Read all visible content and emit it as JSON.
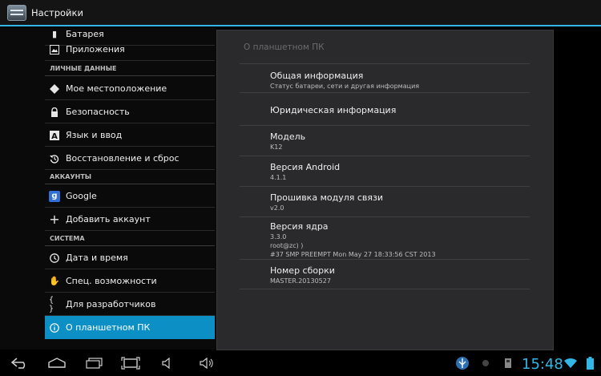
{
  "actionbar": {
    "title": "Настройки"
  },
  "left": {
    "items": [
      {
        "label": "Батарея",
        "icon": "battery-icon"
      },
      {
        "label": "Приложения",
        "icon": "apps-icon"
      },
      {
        "header": "ЛИЧНЫЕ ДАННЫЕ"
      },
      {
        "label": "Мое местоположение",
        "icon": "location-icon"
      },
      {
        "label": "Безопасность",
        "icon": "lock-icon"
      },
      {
        "label": "Язык и ввод",
        "icon": "keyboard-icon"
      },
      {
        "label": "Восстановление и сброс",
        "icon": "restore-icon"
      },
      {
        "header": "АККАУНТЫ"
      },
      {
        "label": "Google",
        "icon": "google-icon"
      },
      {
        "label": "Добавить аккаунт",
        "icon": "add-icon"
      },
      {
        "header": "СИСТЕМА"
      },
      {
        "label": "Дата и время",
        "icon": "clock-icon"
      },
      {
        "label": "Спец. возможности",
        "icon": "hand-icon"
      },
      {
        "label": "Для разработчиков",
        "icon": "braces-icon"
      },
      {
        "label": "О планшетном ПК",
        "icon": "info-icon",
        "selected": true
      }
    ]
  },
  "right": {
    "title": "О планшетном ПК",
    "general": {
      "title": "Общая информация",
      "subtitle": "Статус батареи, сети и другая информация"
    },
    "legal": {
      "title": "Юридическая информация"
    },
    "model": {
      "title": "Модель",
      "value": "K12"
    },
    "android": {
      "title": "Версия Android",
      "value": "4.1.1"
    },
    "baseband": {
      "title": "Прошивка модуля связи",
      "value": "v2.0"
    },
    "kernel": {
      "title": "Версия ядра",
      "line1": "3.3.0",
      "line2": "root@zc) )",
      "line3": "#37 SMP PREEMPT Mon May 27 18:33:56 CST 2013"
    },
    "build": {
      "title": "Номер сборки",
      "value": "MASTER.20130527"
    }
  },
  "status": {
    "time": "15:48"
  }
}
